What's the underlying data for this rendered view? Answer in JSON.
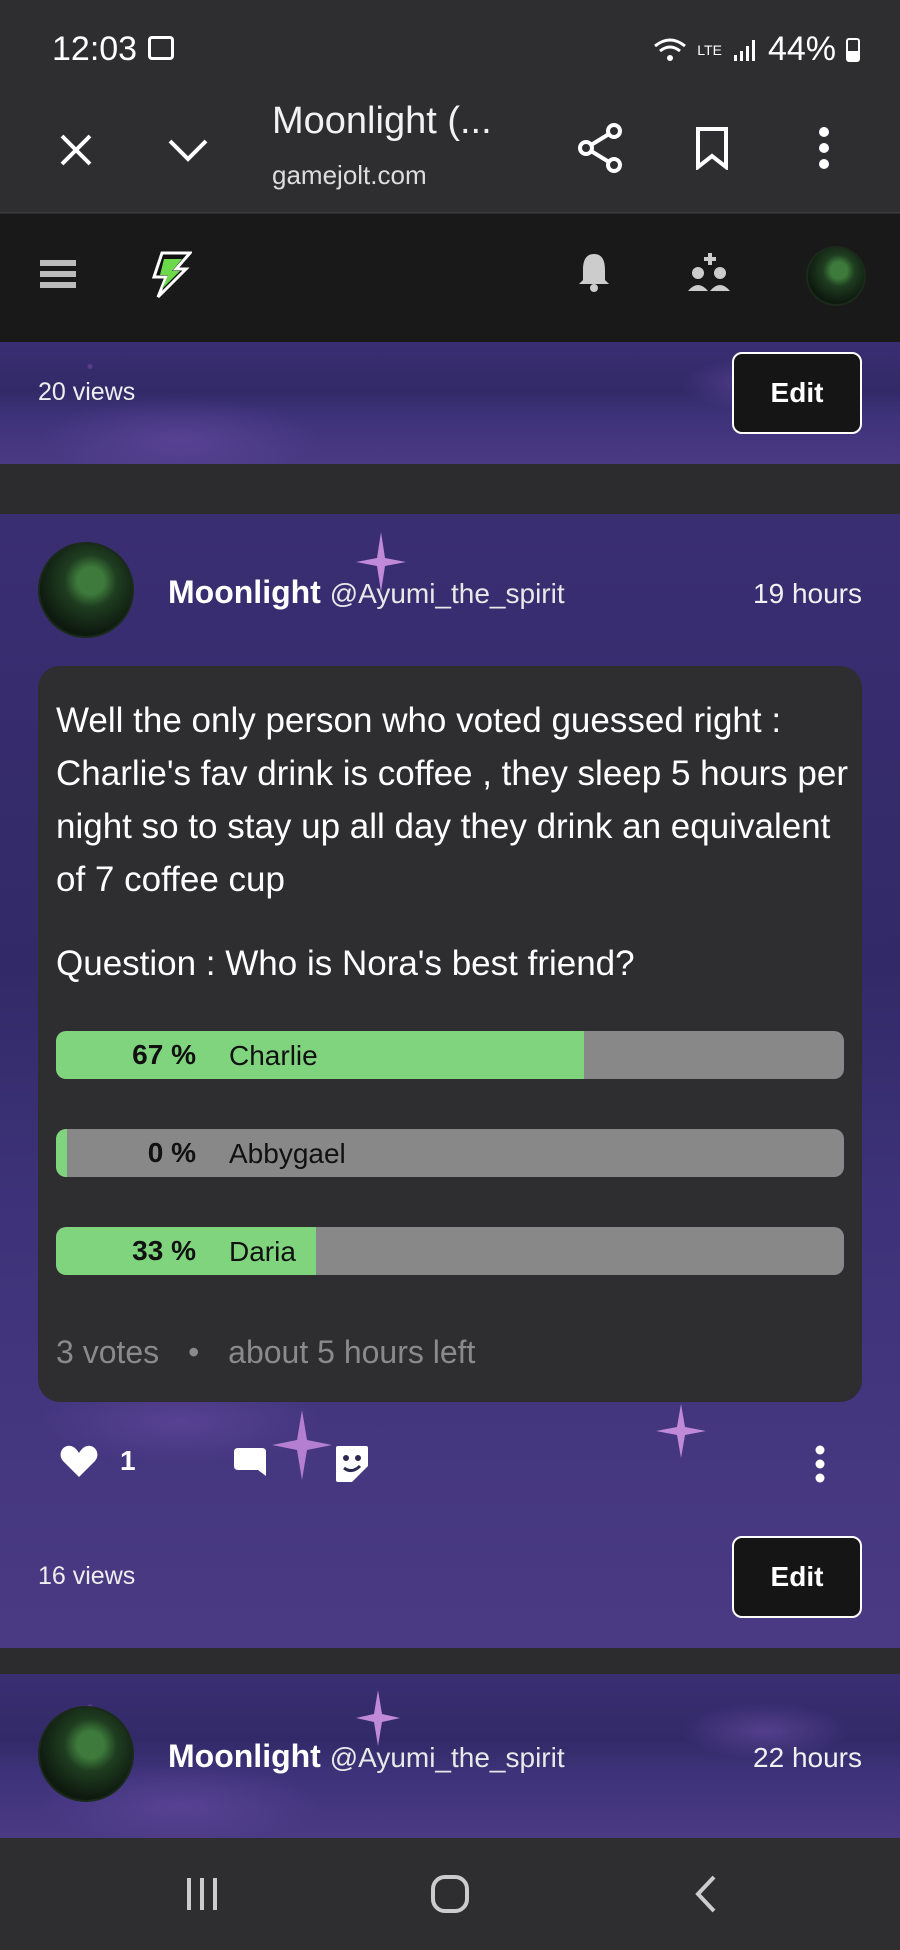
{
  "status_bar": {
    "time": "12:03",
    "battery": "44%",
    "network": "LTE"
  },
  "browser": {
    "title": "Moonlight (...",
    "url": "gamejolt.com"
  },
  "top_card": {
    "views": "20 views",
    "edit_label": "Edit"
  },
  "post": {
    "author_name": "Moonlight",
    "author_handle": "@Ayumi_the_spirit",
    "time": "19 hours",
    "text": "Well the only person who voted guessed right : Charlie's fav drink is coffee , they sleep 5 hours per night so to stay up all day they drink an equivalent of 7 coffee cup",
    "poll": {
      "question": "Question : Who is Nora's best friend?",
      "options": [
        {
          "percent_label": "67 %",
          "label": "Charlie",
          "fraction": 0.67
        },
        {
          "percent_label": "0 %",
          "label": "Abbygael",
          "fraction": 0.0
        },
        {
          "percent_label": "33 %",
          "label": "Daria",
          "fraction": 0.33
        }
      ],
      "votes": "3 votes",
      "time_left": "about 5 hours left"
    },
    "likes": "1",
    "views": "16 views",
    "edit_label": "Edit"
  },
  "next_post": {
    "author_name": "Moonlight",
    "author_handle": "@Ayumi_the_spirit",
    "time": "22 hours"
  },
  "colors": {
    "poll_fill": "#7fd47d",
    "poll_track": "#888888",
    "accent_green": "#6bd94a"
  }
}
